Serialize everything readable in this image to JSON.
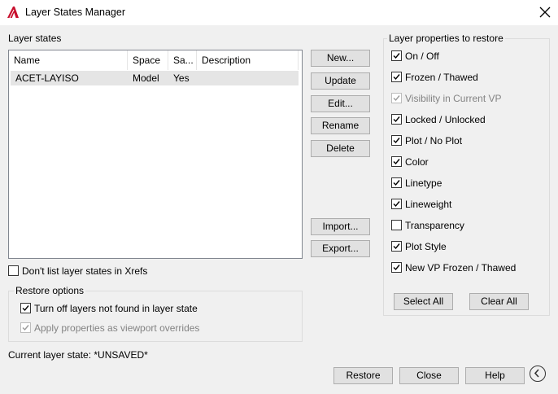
{
  "window": {
    "title": "Layer States Manager",
    "close_glyph": "×"
  },
  "layer_states": {
    "label": "Layer states",
    "columns": [
      "Name",
      "Space",
      "Sa...",
      "Description"
    ],
    "rows": [
      {
        "name": "ACET-LAYISO",
        "space": "Model",
        "saved": "Yes",
        "description": ""
      }
    ]
  },
  "buttons": {
    "new": "New...",
    "update": "Update",
    "edit": "Edit...",
    "rename": "Rename",
    "delete": "Delete",
    "import": "Import...",
    "export": "Export...",
    "select_all": "Select All",
    "clear_all": "Clear All",
    "restore": "Restore",
    "close": "Close",
    "help": "Help"
  },
  "xrefs_option": {
    "label": "Don't list layer states in Xrefs",
    "checked": false
  },
  "restore_options": {
    "label": "Restore options",
    "items": [
      {
        "label": "Turn off layers not found in layer state",
        "checked": true,
        "enabled": true
      },
      {
        "label": "Apply properties as viewport overrides",
        "checked": true,
        "enabled": false
      }
    ]
  },
  "current_state": "Current layer state: *UNSAVED*",
  "properties": {
    "label": "Layer properties to restore",
    "items": [
      {
        "label": "On / Off",
        "checked": true,
        "enabled": true
      },
      {
        "label": "Frozen / Thawed",
        "checked": true,
        "enabled": true
      },
      {
        "label": "Visibility in Current VP",
        "checked": true,
        "enabled": false
      },
      {
        "label": "Locked / Unlocked",
        "checked": true,
        "enabled": true
      },
      {
        "label": "Plot / No Plot",
        "checked": true,
        "enabled": true
      },
      {
        "label": "Color",
        "checked": true,
        "enabled": true
      },
      {
        "label": "Linetype",
        "checked": true,
        "enabled": true
      },
      {
        "label": "Lineweight",
        "checked": true,
        "enabled": true
      },
      {
        "label": "Transparency",
        "checked": false,
        "enabled": true
      },
      {
        "label": "Plot Style",
        "checked": true,
        "enabled": true
      },
      {
        "label": "New VP Frozen / Thawed",
        "checked": true,
        "enabled": true
      }
    ]
  },
  "colors": {
    "app_icon": "#c8102e",
    "selected_row": "#e5e5e5",
    "button_face": "#e1e1e1"
  },
  "icons": {
    "app": "autocad-a-icon",
    "collapse": "chevron-left-circle-icon"
  }
}
